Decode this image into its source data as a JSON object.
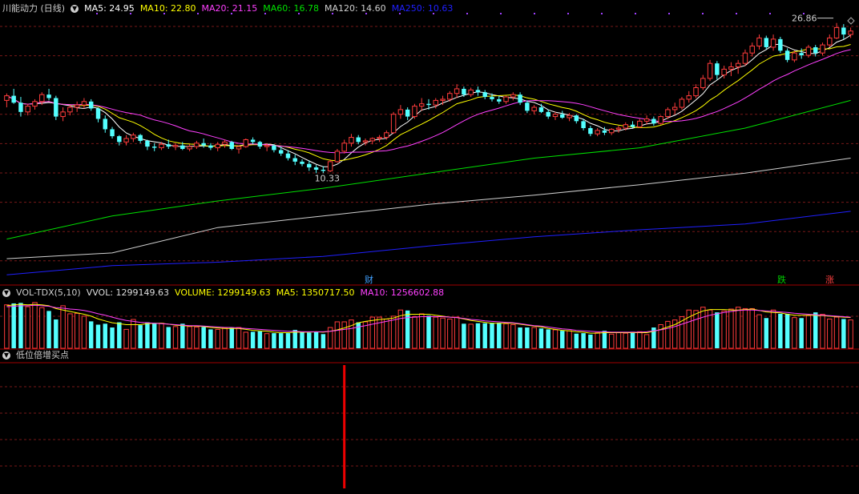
{
  "main_header": {
    "title": "川能动力 (日线)",
    "toggle_icon": "collapse-triangle-icon",
    "ma_items": [
      {
        "label": "MA5: 24.95",
        "color": "#ffffff"
      },
      {
        "label": "MA10: 22.80",
        "color": "#ffff00"
      },
      {
        "label": "MA20: 21.15",
        "color": "#ff40ff"
      },
      {
        "label": "MA60: 16.78",
        "color": "#00e000"
      },
      {
        "label": "MA120: 14.60",
        "color": "#d0d0d0"
      },
      {
        "label": "MA250: 10.63",
        "color": "#2020ff"
      }
    ]
  },
  "vol_header": {
    "title": "VOL-TDX(5,10)",
    "items": [
      {
        "label": "VVOL: 1299149.63",
        "color": "#dddddd"
      },
      {
        "label": "VOLUME: 1299149.63",
        "color": "#ffff00"
      },
      {
        "label": "MA5: 1350717.50",
        "color": "#ffff00"
      },
      {
        "label": "MA10: 1256602.88",
        "color": "#ff40ff"
      }
    ]
  },
  "ind_header": {
    "title": "低位倍增买点"
  },
  "annotations": {
    "high_label": "26.86",
    "low_label": "10.33",
    "badges": [
      {
        "text": "财",
        "color": "#40a0ff"
      },
      {
        "text": "跌",
        "color": "#00d000"
      },
      {
        "text": "涨",
        "color": "#ff4040"
      }
    ]
  },
  "colors": {
    "up": "#ff3c3c",
    "down": "#54ffff",
    "grid": "#781818",
    "separator": "#a00000",
    "signal": "#ee0000"
  },
  "chart_data": {
    "type": "candlestick",
    "price_series": {
      "candles": [
        [
          20.2,
          20.8,
          19.6,
          20.6
        ],
        [
          20.6,
          21.2,
          19.9,
          20.0
        ],
        [
          20.0,
          20.5,
          18.8,
          19.2
        ],
        [
          19.2,
          19.9,
          18.9,
          19.7
        ],
        [
          19.7,
          20.3,
          19.4,
          20.1
        ],
        [
          20.1,
          20.9,
          19.8,
          20.7
        ],
        [
          20.7,
          21.2,
          20.2,
          20.4
        ],
        [
          20.4,
          20.6,
          18.5,
          18.8
        ],
        [
          18.8,
          19.6,
          18.4,
          19.2
        ],
        [
          19.2,
          19.8,
          18.9,
          19.6
        ],
        [
          19.6,
          20.1,
          19.2,
          19.8
        ],
        [
          19.8,
          20.4,
          19.5,
          20.1
        ],
        [
          20.1,
          20.3,
          19.3,
          19.5
        ],
        [
          19.5,
          19.6,
          18.3,
          18.6
        ],
        [
          18.6,
          18.9,
          17.4,
          17.7
        ],
        [
          17.7,
          17.9,
          16.9,
          17.1
        ],
        [
          17.1,
          17.2,
          16.3,
          16.6
        ],
        [
          16.6,
          17.2,
          16.3,
          16.9
        ],
        [
          16.9,
          17.4,
          16.6,
          17.2
        ],
        [
          17.2,
          17.3,
          16.5,
          16.7
        ],
        [
          16.7,
          16.8,
          15.9,
          16.2
        ],
        [
          16.2,
          16.5,
          15.8,
          16.1
        ],
        [
          16.1,
          16.6,
          15.9,
          16.4
        ],
        [
          16.4,
          16.8,
          16.0,
          16.2
        ],
        [
          16.2,
          16.5,
          15.9,
          16.3
        ],
        [
          16.3,
          16.6,
          15.9,
          16.0
        ],
        [
          16.0,
          16.4,
          15.8,
          16.2
        ],
        [
          16.2,
          16.7,
          16.0,
          16.5
        ],
        [
          16.5,
          16.9,
          16.1,
          16.3
        ],
        [
          16.3,
          16.5,
          15.9,
          16.1
        ],
        [
          16.1,
          16.6,
          15.8,
          16.4
        ],
        [
          16.4,
          16.8,
          16.1,
          16.6
        ],
        [
          16.6,
          16.7,
          15.9,
          16.0
        ],
        [
          16.0,
          16.3,
          15.6,
          16.2
        ],
        [
          16.2,
          16.9,
          16.1,
          16.8
        ],
        [
          16.8,
          17.0,
          16.4,
          16.6
        ],
        [
          16.6,
          16.7,
          16.0,
          16.2
        ],
        [
          16.2,
          16.5,
          15.8,
          16.3
        ],
        [
          16.3,
          16.4,
          15.7,
          15.9
        ],
        [
          15.9,
          16.2,
          15.4,
          15.6
        ],
        [
          15.6,
          15.9,
          15.0,
          15.2
        ],
        [
          15.2,
          15.5,
          14.6,
          14.9
        ],
        [
          14.9,
          15.1,
          14.5,
          14.7
        ],
        [
          14.7,
          15.0,
          14.1,
          14.4
        ],
        [
          14.4,
          14.6,
          13.9,
          14.2
        ],
        [
          14.2,
          14.5,
          13.9,
          14.1
        ],
        [
          14.1,
          15.1,
          14.0,
          14.9
        ],
        [
          14.9,
          16.0,
          14.8,
          15.8
        ],
        [
          15.8,
          16.8,
          15.6,
          16.5
        ],
        [
          16.5,
          17.3,
          16.2,
          17.0
        ],
        [
          17.0,
          17.2,
          16.4,
          16.6
        ],
        [
          16.6,
          16.9,
          16.3,
          16.7
        ],
        [
          16.7,
          17.0,
          16.4,
          16.9
        ],
        [
          16.9,
          17.2,
          16.6,
          17.0
        ],
        [
          17.0,
          17.6,
          16.8,
          17.4
        ],
        [
          17.4,
          19.2,
          17.3,
          19.0
        ],
        [
          19.0,
          19.8,
          18.6,
          19.4
        ],
        [
          19.4,
          19.6,
          18.5,
          18.8
        ],
        [
          18.8,
          19.9,
          18.6,
          19.7
        ],
        [
          19.7,
          20.4,
          19.3,
          19.9
        ],
        [
          19.9,
          20.3,
          19.4,
          19.8
        ],
        [
          19.8,
          20.4,
          19.5,
          20.2
        ],
        [
          20.2,
          20.6,
          19.8,
          20.3
        ],
        [
          20.3,
          21.0,
          20.1,
          20.8
        ],
        [
          20.8,
          21.6,
          20.4,
          21.2
        ],
        [
          21.2,
          21.4,
          20.5,
          20.7
        ],
        [
          20.7,
          21.3,
          20.5,
          21.1
        ],
        [
          21.1,
          21.4,
          20.6,
          20.9
        ],
        [
          20.9,
          21.1,
          20.3,
          20.5
        ],
        [
          20.5,
          20.8,
          20.1,
          20.3
        ],
        [
          20.3,
          20.6,
          19.9,
          20.1
        ],
        [
          20.1,
          20.6,
          19.9,
          20.5
        ],
        [
          20.5,
          20.9,
          20.2,
          20.7
        ],
        [
          20.7,
          20.9,
          19.8,
          20.0
        ],
        [
          20.0,
          20.2,
          19.1,
          19.3
        ],
        [
          19.3,
          19.8,
          19.0,
          19.6
        ],
        [
          19.6,
          19.9,
          19.1,
          19.2
        ],
        [
          19.2,
          19.4,
          18.6,
          18.8
        ],
        [
          18.8,
          19.2,
          18.5,
          19.0
        ],
        [
          19.0,
          19.3,
          18.6,
          18.7
        ],
        [
          18.7,
          19.1,
          18.4,
          18.9
        ],
        [
          18.9,
          19.0,
          18.2,
          18.4
        ],
        [
          18.4,
          18.6,
          17.6,
          17.8
        ],
        [
          17.8,
          18.0,
          17.1,
          17.3
        ],
        [
          17.3,
          17.8,
          17.1,
          17.6
        ],
        [
          17.6,
          17.9,
          17.2,
          17.4
        ],
        [
          17.4,
          17.8,
          17.2,
          17.7
        ],
        [
          17.7,
          18.0,
          17.4,
          17.8
        ],
        [
          17.8,
          18.3,
          17.6,
          18.1
        ],
        [
          18.1,
          18.4,
          17.8,
          17.9
        ],
        [
          17.9,
          18.6,
          17.8,
          18.4
        ],
        [
          18.4,
          18.9,
          18.1,
          18.6
        ],
        [
          18.6,
          18.8,
          18.0,
          18.2
        ],
        [
          18.2,
          18.9,
          18.1,
          18.8
        ],
        [
          18.8,
          19.6,
          18.6,
          19.4
        ],
        [
          19.4,
          20.0,
          19.0,
          19.6
        ],
        [
          19.6,
          20.5,
          19.4,
          20.3
        ],
        [
          20.3,
          21.0,
          20.0,
          20.6
        ],
        [
          20.6,
          21.6,
          20.4,
          21.3
        ],
        [
          21.3,
          22.4,
          21.1,
          22.1
        ],
        [
          22.1,
          23.7,
          21.9,
          23.4
        ],
        [
          23.4,
          23.6,
          22.0,
          22.4
        ],
        [
          22.4,
          23.2,
          22.1,
          22.9
        ],
        [
          22.9,
          23.5,
          22.3,
          23.1
        ],
        [
          23.1,
          23.7,
          22.5,
          23.4
        ],
        [
          23.4,
          24.6,
          23.2,
          24.3
        ],
        [
          24.3,
          25.2,
          24.0,
          24.9
        ],
        [
          24.9,
          25.9,
          24.6,
          25.6
        ],
        [
          25.6,
          25.8,
          24.6,
          24.8
        ],
        [
          24.8,
          25.9,
          24.5,
          25.5
        ],
        [
          25.5,
          25.7,
          24.3,
          24.5
        ],
        [
          24.5,
          24.7,
          23.5,
          23.7
        ],
        [
          23.7,
          24.5,
          23.5,
          24.3
        ],
        [
          24.3,
          24.7,
          23.8,
          24.1
        ],
        [
          24.1,
          25.0,
          23.9,
          24.8
        ],
        [
          24.8,
          25.0,
          24.0,
          24.3
        ],
        [
          24.3,
          25.2,
          24.1,
          25.0
        ],
        [
          25.0,
          25.9,
          24.8,
          25.6
        ],
        [
          25.6,
          26.9,
          25.5,
          26.5
        ],
        [
          26.5,
          26.8,
          25.5,
          25.9
        ],
        [
          25.9,
          26.5,
          25.6,
          26.2
        ]
      ],
      "ma": [
        {
          "name": "MA5",
          "color": "#ffffff",
          "period": 5
        },
        {
          "name": "MA10",
          "color": "#ffff00",
          "period": 10
        },
        {
          "name": "MA20",
          "color": "#ff40ff",
          "period": 20
        },
        {
          "name": "MA60",
          "color": "#00e000",
          "curve": [
            [
              0,
              8.2
            ],
            [
              15,
              10.2
            ],
            [
              30,
              11.5
            ],
            [
              45,
              12.6
            ],
            [
              60,
              13.9
            ],
            [
              75,
              15.2
            ],
            [
              90,
              16.1
            ],
            [
              105,
              17.8
            ],
            [
              120,
              20.2
            ]
          ]
        },
        {
          "name": "MA120",
          "color": "#d0d0d0",
          "curve": [
            [
              0,
              6.5
            ],
            [
              15,
              7.0
            ],
            [
              30,
              9.2
            ],
            [
              45,
              10.2
            ],
            [
              60,
              11.2
            ],
            [
              75,
              12.0
            ],
            [
              90,
              12.9
            ],
            [
              105,
              13.9
            ],
            [
              120,
              15.2
            ]
          ]
        },
        {
          "name": "MA250",
          "color": "#2020ff",
          "curve": [
            [
              0,
              5.1
            ],
            [
              15,
              5.9
            ],
            [
              30,
              6.2
            ],
            [
              45,
              6.7
            ],
            [
              60,
              7.6
            ],
            [
              75,
              8.4
            ],
            [
              90,
              9.0
            ],
            [
              105,
              9.5
            ],
            [
              120,
              10.6
            ]
          ]
        }
      ],
      "ylim": [
        4.5,
        27.5
      ]
    },
    "volume_series": {
      "values": [
        0.92,
        0.95,
        0.96,
        0.88,
        0.97,
        0.86,
        0.79,
        0.61,
        0.9,
        0.73,
        0.74,
        0.68,
        0.57,
        0.5,
        0.52,
        0.44,
        0.55,
        0.4,
        0.61,
        0.49,
        0.55,
        0.53,
        0.53,
        0.45,
        0.46,
        0.52,
        0.46,
        0.45,
        0.45,
        0.4,
        0.4,
        0.43,
        0.43,
        0.44,
        0.34,
        0.35,
        0.36,
        0.31,
        0.32,
        0.32,
        0.32,
        0.39,
        0.34,
        0.33,
        0.35,
        0.3,
        0.44,
        0.56,
        0.56,
        0.6,
        0.55,
        0.56,
        0.66,
        0.66,
        0.62,
        0.68,
        0.81,
        0.8,
        0.67,
        0.73,
        0.69,
        0.66,
        0.64,
        0.62,
        0.66,
        0.52,
        0.51,
        0.53,
        0.53,
        0.54,
        0.54,
        0.52,
        0.5,
        0.44,
        0.44,
        0.44,
        0.42,
        0.4,
        0.39,
        0.37,
        0.37,
        0.31,
        0.32,
        0.29,
        0.33,
        0.37,
        0.3,
        0.33,
        0.32,
        0.35,
        0.35,
        0.29,
        0.44,
        0.5,
        0.57,
        0.6,
        0.67,
        0.81,
        0.8,
        0.87,
        0.81,
        0.76,
        0.79,
        0.83,
        0.87,
        0.84,
        0.84,
        0.71,
        0.64,
        0.81,
        0.73,
        0.73,
        0.65,
        0.64,
        0.69,
        0.76,
        0.72,
        0.62,
        0.66,
        0.62,
        0.6
      ],
      "ma5": [
        0.9,
        0.92,
        0.93,
        0.92,
        0.93,
        0.92,
        0.9,
        0.84,
        0.81,
        0.78,
        0.75,
        0.72,
        0.68,
        0.62,
        0.58,
        0.54,
        0.52,
        0.5,
        0.5,
        0.5,
        0.52,
        0.53,
        0.53,
        0.51,
        0.49,
        0.48,
        0.47,
        0.47,
        0.46,
        0.44,
        0.43,
        0.42,
        0.42,
        0.42,
        0.4,
        0.38,
        0.37,
        0.36,
        0.34,
        0.33,
        0.33,
        0.34,
        0.34,
        0.34,
        0.35,
        0.34,
        0.36,
        0.39,
        0.43,
        0.48,
        0.54,
        0.57,
        0.59,
        0.61,
        0.62,
        0.64,
        0.69,
        0.72,
        0.72,
        0.72,
        0.72,
        0.7,
        0.68,
        0.66,
        0.65,
        0.62,
        0.59,
        0.57,
        0.55,
        0.53,
        0.53,
        0.53,
        0.53,
        0.51,
        0.49,
        0.47,
        0.45,
        0.42,
        0.4,
        0.38,
        0.37,
        0.35,
        0.34,
        0.32,
        0.32,
        0.33,
        0.33,
        0.33,
        0.33,
        0.33,
        0.33,
        0.33,
        0.36,
        0.4,
        0.45,
        0.5,
        0.58,
        0.66,
        0.73,
        0.79,
        0.82,
        0.82,
        0.82,
        0.81,
        0.81,
        0.82,
        0.83,
        0.8,
        0.77,
        0.76,
        0.75,
        0.72,
        0.7,
        0.7,
        0.7,
        0.7,
        0.69,
        0.68,
        0.67,
        0.66,
        0.65
      ],
      "ma10": [
        0.88,
        0.89,
        0.9,
        0.9,
        0.91,
        0.9,
        0.89,
        0.86,
        0.85,
        0.83,
        0.82,
        0.8,
        0.77,
        0.73,
        0.7,
        0.66,
        0.62,
        0.59,
        0.57,
        0.55,
        0.54,
        0.53,
        0.52,
        0.51,
        0.5,
        0.49,
        0.48,
        0.48,
        0.47,
        0.46,
        0.45,
        0.44,
        0.44,
        0.43,
        0.42,
        0.41,
        0.4,
        0.39,
        0.38,
        0.37,
        0.36,
        0.36,
        0.35,
        0.35,
        0.35,
        0.35,
        0.36,
        0.38,
        0.4,
        0.42,
        0.45,
        0.48,
        0.51,
        0.54,
        0.57,
        0.6,
        0.63,
        0.65,
        0.66,
        0.67,
        0.67,
        0.67,
        0.67,
        0.66,
        0.65,
        0.63,
        0.61,
        0.6,
        0.58,
        0.57,
        0.56,
        0.55,
        0.54,
        0.52,
        0.5,
        0.48,
        0.47,
        0.45,
        0.43,
        0.41,
        0.4,
        0.38,
        0.37,
        0.36,
        0.35,
        0.35,
        0.34,
        0.34,
        0.34,
        0.34,
        0.34,
        0.35,
        0.37,
        0.39,
        0.42,
        0.46,
        0.51,
        0.56,
        0.61,
        0.66,
        0.7,
        0.73,
        0.76,
        0.78,
        0.8,
        0.81,
        0.81,
        0.8,
        0.79,
        0.78,
        0.77,
        0.76,
        0.74,
        0.73,
        0.72,
        0.71,
        0.7,
        0.69,
        0.68,
        0.67,
        0.66
      ]
    },
    "indicator": {
      "name": "低位倍增买点",
      "signal_index": 48
    }
  }
}
